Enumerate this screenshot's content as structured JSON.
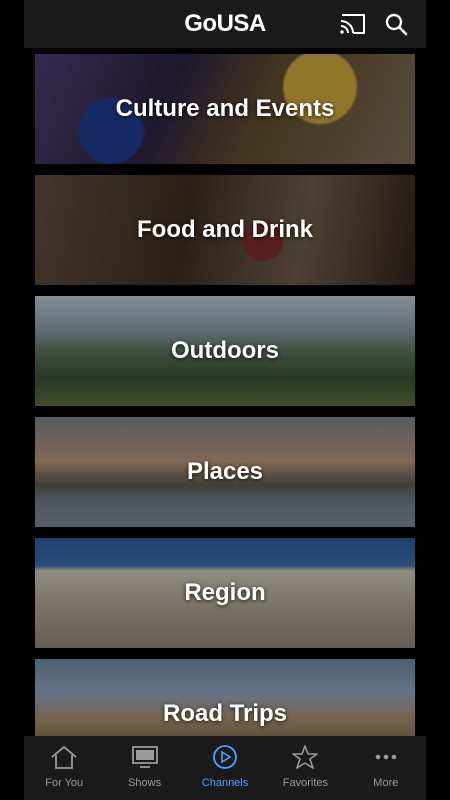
{
  "header": {
    "logo_text_pre": "G",
    "logo_text_o": "o",
    "logo_text_post": "USA"
  },
  "channels": [
    {
      "label": "Culture and Events"
    },
    {
      "label": "Food and Drink"
    },
    {
      "label": "Outdoors"
    },
    {
      "label": "Places"
    },
    {
      "label": "Region"
    },
    {
      "label": "Road Trips"
    }
  ],
  "tabs": [
    {
      "label": "For You",
      "icon": "house-icon"
    },
    {
      "label": "Shows",
      "icon": "tv-icon"
    },
    {
      "label": "Channels",
      "icon": "play-circle-icon",
      "active": true
    },
    {
      "label": "Favorites",
      "icon": "star-icon"
    },
    {
      "label": "More",
      "icon": "dots-icon"
    }
  ],
  "colors": {
    "accent": "#4da3ff",
    "bar": "#1a1a1a",
    "inactive": "#9a9a9a"
  }
}
